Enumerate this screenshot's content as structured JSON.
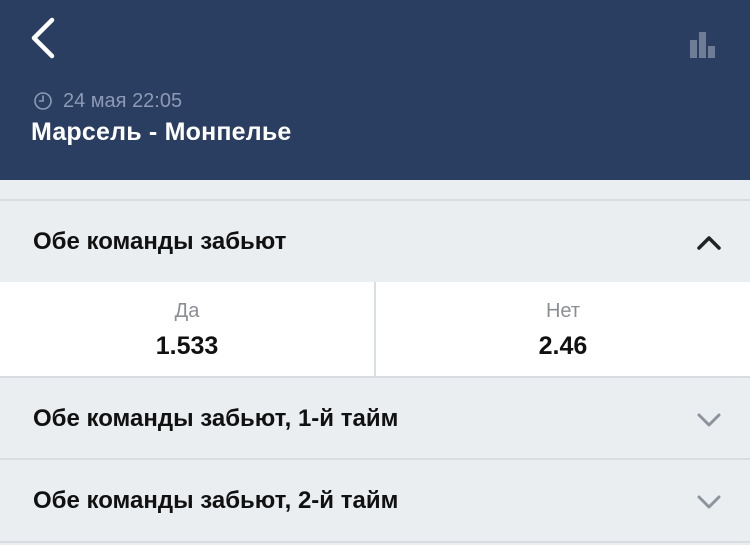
{
  "header": {
    "back_icon": "chevron-left-icon",
    "stats_icon": "bar-chart-icon",
    "clock_icon": "clock-icon",
    "datetime": "24 мая 22:05",
    "match": "Марсель - Монпелье",
    "colors": {
      "background": "#2a3e62",
      "title": "#ffffff",
      "subtitle": "#8c9ab5"
    }
  },
  "markets": [
    {
      "title": "Обе команды забьют",
      "expanded": true,
      "icon": "chevron-up-icon",
      "outcomes": [
        {
          "name": "Да",
          "odd": "1.533"
        },
        {
          "name": "Нет",
          "odd": "2.46"
        }
      ]
    },
    {
      "title": "Обе команды забьют, 1-й тайм",
      "expanded": false,
      "icon": "chevron-down-icon"
    },
    {
      "title": "Обе команды забьют, 2-й тайм",
      "expanded": false,
      "icon": "chevron-down-icon"
    }
  ]
}
